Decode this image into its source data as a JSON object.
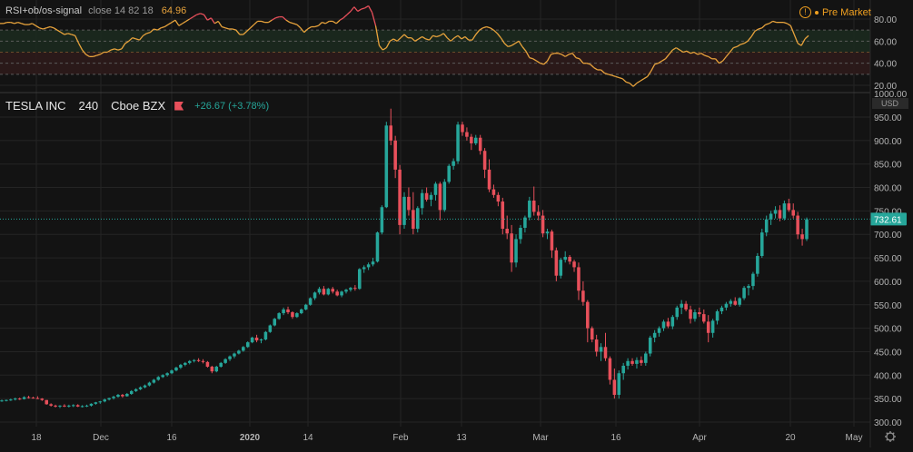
{
  "rsi": {
    "name": "RSI+ob/os-signal",
    "params": "close 14 82 18",
    "value": "64.96",
    "axis_labels": [
      "80.00",
      "60.00",
      "40.00",
      "20.00"
    ],
    "line_color": "#e8a33c",
    "ob_color": "#e8505b"
  },
  "status": {
    "label": "Pre Market",
    "icon": "info-circle-icon"
  },
  "symbol": {
    "title": "TESLA INC",
    "interval": "240",
    "exchange": "Cboe BZX",
    "change": "+26.67 (+3.78%)",
    "flag_icon": "flag-icon"
  },
  "price_axis": {
    "top_label": "1000.00",
    "currency": "USD",
    "labels": [
      "950.00",
      "900.00",
      "850.00",
      "800.00",
      "750.00",
      "700.00",
      "650.00",
      "600.00",
      "550.00",
      "500.00",
      "450.00",
      "400.00",
      "350.00",
      "300.00"
    ],
    "last_price": "732.61"
  },
  "time_axis": {
    "labels": [
      "18",
      "Dec",
      "16",
      "2020",
      "14",
      "Feb",
      "13",
      "Mar",
      "16",
      "Apr",
      "20",
      "May"
    ]
  },
  "settings_icon": "gear-icon",
  "colors": {
    "up": "#26a69a",
    "down": "#e8505b",
    "bg": "#131313",
    "grid": "#242424",
    "text": "#b4b4b4"
  },
  "chart_data": [
    {
      "type": "candlestick",
      "title": "TESLA INC",
      "ylabel": "USD",
      "ylim": [
        290,
        1010
      ],
      "ohlc_approx": [
        [
          346,
          348,
          343,
          346
        ],
        [
          346,
          348,
          344,
          347
        ],
        [
          347,
          350,
          345,
          348
        ],
        [
          348,
          352,
          346,
          350
        ],
        [
          350,
          352,
          347,
          349
        ],
        [
          349,
          355,
          348,
          353
        ],
        [
          353,
          356,
          350,
          352
        ],
        [
          352,
          354,
          350,
          351
        ],
        [
          351,
          355,
          349,
          350
        ],
        [
          350,
          351,
          345,
          347
        ],
        [
          347,
          347,
          337,
          338
        ],
        [
          338,
          340,
          333,
          335
        ],
        [
          335,
          337,
          331,
          333
        ],
        [
          333,
          336,
          330,
          335
        ],
        [
          335,
          338,
          332,
          334
        ],
        [
          334,
          337,
          331,
          335
        ],
        [
          335,
          338,
          332,
          336
        ],
        [
          336,
          338,
          332,
          333
        ],
        [
          333,
          336,
          331,
          334
        ],
        [
          334,
          337,
          332,
          335
        ],
        [
          335,
          340,
          333,
          339
        ],
        [
          339,
          343,
          337,
          342
        ],
        [
          342,
          345,
          339,
          344
        ],
        [
          344,
          350,
          342,
          348
        ],
        [
          348,
          352,
          346,
          351
        ],
        [
          351,
          356,
          348,
          354
        ],
        [
          354,
          360,
          352,
          358
        ],
        [
          358,
          360,
          352,
          355
        ],
        [
          355,
          362,
          354,
          360
        ],
        [
          360,
          368,
          358,
          366
        ],
        [
          366,
          372,
          364,
          370
        ],
        [
          370,
          376,
          368,
          374
        ],
        [
          374,
          380,
          372,
          378
        ],
        [
          378,
          386,
          376,
          384
        ],
        [
          384,
          392,
          382,
          390
        ],
        [
          390,
          398,
          388,
          396
        ],
        [
          396,
          402,
          394,
          400
        ],
        [
          400,
          406,
          397,
          404
        ],
        [
          404,
          412,
          402,
          410
        ],
        [
          410,
          418,
          408,
          416
        ],
        [
          416,
          424,
          413,
          422
        ],
        [
          422,
          428,
          419,
          426
        ],
        [
          426,
          432,
          423,
          430
        ],
        [
          430,
          434,
          427,
          432
        ],
        [
          432,
          436,
          428,
          430
        ],
        [
          430,
          434,
          425,
          428
        ],
        [
          428,
          430,
          416,
          418
        ],
        [
          418,
          420,
          404,
          408
        ],
        [
          408,
          420,
          406,
          418
        ],
        [
          418,
          428,
          416,
          426
        ],
        [
          426,
          436,
          424,
          434
        ],
        [
          434,
          442,
          430,
          440
        ],
        [
          440,
          448,
          436,
          446
        ],
        [
          446,
          454,
          444,
          452
        ],
        [
          452,
          462,
          450,
          460
        ],
        [
          460,
          472,
          458,
          470
        ],
        [
          470,
          482,
          468,
          480
        ],
        [
          480,
          486,
          470,
          474
        ],
        [
          474,
          478,
          468,
          476
        ],
        [
          476,
          494,
          474,
          492
        ],
        [
          492,
          508,
          490,
          506
        ],
        [
          506,
          522,
          504,
          520
        ],
        [
          520,
          534,
          518,
          532
        ],
        [
          532,
          544,
          528,
          540
        ],
        [
          540,
          546,
          530,
          534
        ],
        [
          534,
          536,
          520,
          524
        ],
        [
          524,
          534,
          522,
          532
        ],
        [
          532,
          542,
          530,
          540
        ],
        [
          540,
          552,
          538,
          550
        ],
        [
          550,
          566,
          548,
          564
        ],
        [
          564,
          578,
          560,
          576
        ],
        [
          576,
          588,
          572,
          584
        ],
        [
          584,
          590,
          570,
          572
        ],
        [
          572,
          586,
          570,
          584
        ],
        [
          584,
          588,
          574,
          578
        ],
        [
          578,
          582,
          568,
          570
        ],
        [
          570,
          580,
          566,
          578
        ],
        [
          578,
          584,
          574,
          582
        ],
        [
          582,
          588,
          578,
          586
        ],
        [
          586,
          592,
          580,
          584
        ],
        [
          584,
          628,
          582,
          626
        ],
        [
          626,
          634,
          618,
          630
        ],
        [
          630,
          640,
          624,
          636
        ],
        [
          636,
          650,
          632,
          642
        ],
        [
          642,
          706,
          640,
          704
        ],
        [
          704,
          762,
          700,
          758
        ],
        [
          758,
          940,
          756,
          932
        ],
        [
          932,
          968,
          890,
          900
        ],
        [
          900,
          910,
          820,
          838
        ],
        [
          838,
          848,
          700,
          720
        ],
        [
          720,
          790,
          712,
          780
        ],
        [
          780,
          800,
          740,
          752
        ],
        [
          752,
          790,
          700,
          712
        ],
        [
          712,
          760,
          704,
          756
        ],
        [
          756,
          796,
          742,
          788
        ],
        [
          788,
          800,
          770,
          774
        ],
        [
          774,
          790,
          760,
          784
        ],
        [
          784,
          812,
          772,
          808
        ],
        [
          808,
          812,
          730,
          752
        ],
        [
          752,
          818,
          748,
          812
        ],
        [
          812,
          850,
          808,
          846
        ],
        [
          846,
          862,
          838,
          856
        ],
        [
          856,
          940,
          850,
          934
        ],
        [
          934,
          940,
          910,
          918
        ],
        [
          918,
          928,
          900,
          908
        ],
        [
          908,
          914,
          880,
          894
        ],
        [
          894,
          912,
          890,
          906
        ],
        [
          906,
          912,
          870,
          878
        ],
        [
          878,
          884,
          820,
          838
        ],
        [
          838,
          860,
          790,
          796
        ],
        [
          796,
          806,
          778,
          784
        ],
        [
          784,
          790,
          760,
          770
        ],
        [
          770,
          778,
          700,
          712
        ],
        [
          712,
          740,
          690,
          702
        ],
        [
          702,
          720,
          620,
          640
        ],
        [
          640,
          700,
          630,
          690
        ],
        [
          690,
          720,
          680,
          714
        ],
        [
          714,
          740,
          704,
          736
        ],
        [
          736,
          780,
          730,
          772
        ],
        [
          772,
          802,
          740,
          748
        ],
        [
          748,
          762,
          730,
          740
        ],
        [
          740,
          752,
          694,
          702
        ],
        [
          702,
          712,
          690,
          706
        ],
        [
          706,
          710,
          650,
          666
        ],
        [
          666,
          672,
          600,
          612
        ],
        [
          612,
          650,
          606,
          646
        ],
        [
          646,
          664,
          640,
          652
        ],
        [
          652,
          656,
          636,
          642
        ],
        [
          642,
          646,
          620,
          630
        ],
        [
          630,
          640,
          560,
          580
        ],
        [
          580,
          600,
          548,
          556
        ],
        [
          556,
          560,
          470,
          500
        ],
        [
          500,
          504,
          470,
          476
        ],
        [
          476,
          486,
          440,
          450
        ],
        [
          450,
          468,
          430,
          460
        ],
        [
          460,
          490,
          430,
          436
        ],
        [
          436,
          440,
          380,
          390
        ],
        [
          390,
          414,
          350,
          358
        ],
        [
          358,
          410,
          350,
          404
        ],
        [
          404,
          426,
          390,
          420
        ],
        [
          420,
          436,
          412,
          430
        ],
        [
          430,
          436,
          420,
          424
        ],
        [
          424,
          438,
          414,
          432
        ],
        [
          432,
          440,
          420,
          426
        ],
        [
          426,
          450,
          420,
          446
        ],
        [
          446,
          484,
          440,
          480
        ],
        [
          480,
          496,
          470,
          490
        ],
        [
          490,
          504,
          482,
          500
        ],
        [
          500,
          518,
          494,
          514
        ],
        [
          514,
          522,
          500,
          504
        ],
        [
          504,
          528,
          498,
          524
        ],
        [
          524,
          548,
          518,
          544
        ],
        [
          544,
          560,
          530,
          552
        ],
        [
          552,
          558,
          536,
          540
        ],
        [
          540,
          548,
          510,
          520
        ],
        [
          520,
          540,
          514,
          534
        ],
        [
          534,
          544,
          524,
          530
        ],
        [
          530,
          540,
          510,
          514
        ],
        [
          514,
          528,
          470,
          490
        ],
        [
          490,
          520,
          480,
          516
        ],
        [
          516,
          540,
          508,
          536
        ],
        [
          536,
          548,
          530,
          544
        ],
        [
          544,
          556,
          538,
          552
        ],
        [
          552,
          562,
          546,
          558
        ],
        [
          558,
          566,
          548,
          550
        ],
        [
          550,
          566,
          546,
          564
        ],
        [
          564,
          590,
          560,
          586
        ],
        [
          586,
          594,
          570,
          590
        ],
        [
          590,
          620,
          582,
          616
        ],
        [
          616,
          660,
          610,
          654
        ],
        [
          654,
          712,
          650,
          704
        ],
        [
          704,
          740,
          696,
          732
        ],
        [
          732,
          750,
          720,
          744
        ],
        [
          744,
          760,
          734,
          752
        ],
        [
          752,
          762,
          728,
          734
        ],
        [
          734,
          772,
          730,
          766
        ],
        [
          766,
          776,
          748,
          752
        ],
        [
          752,
          766,
          734,
          740
        ],
        [
          740,
          748,
          690,
          700
        ],
        [
          700,
          712,
          676,
          690
        ],
        [
          690,
          736,
          686,
          732
        ]
      ]
    },
    {
      "type": "line",
      "title": "RSI+ob/os-signal",
      "ylim": [
        15,
        95
      ],
      "reference_lines": [
        30,
        40,
        50,
        60,
        70
      ],
      "values": [
        76,
        76,
        77,
        77,
        76,
        77,
        76,
        75,
        75,
        76,
        74,
        72,
        71,
        72,
        73,
        72,
        70,
        68,
        66,
        67,
        66,
        65,
        58,
        52,
        48,
        46,
        46,
        47,
        48,
        50,
        50,
        52,
        53,
        52,
        53,
        58,
        60,
        63,
        62,
        61,
        65,
        67,
        68,
        71,
        70,
        72,
        73,
        75,
        77,
        79,
        74,
        76,
        78,
        80,
        82,
        84,
        85,
        84,
        79,
        81,
        76,
        78,
        73,
        72,
        71,
        71,
        70,
        66,
        66,
        69,
        72,
        75,
        78,
        78,
        77,
        77,
        79,
        81,
        82,
        82,
        79,
        77,
        76,
        75,
        72,
        68,
        71,
        73,
        73,
        74,
        77,
        76,
        78,
        78,
        76,
        79,
        81,
        84,
        87,
        91,
        87,
        89,
        90,
        92,
        86,
        74,
        56,
        52,
        54,
        60,
        62,
        60,
        63,
        66,
        63,
        63,
        60,
        62,
        64,
        62,
        61,
        65,
        64,
        65,
        67,
        63,
        60,
        63,
        65,
        62,
        64,
        61,
        61,
        66,
        70,
        72,
        73,
        72,
        70,
        67,
        63,
        58,
        55,
        56,
        58,
        60,
        55,
        51,
        45,
        44,
        42,
        40,
        39,
        42,
        48,
        49,
        49,
        48,
        46,
        48,
        49,
        45,
        44,
        40,
        40,
        39,
        36,
        34,
        34,
        31,
        30,
        29,
        28,
        27,
        26,
        23,
        22,
        19,
        22,
        24,
        26,
        28,
        33,
        39,
        40,
        42,
        44,
        48,
        52,
        54,
        52,
        50,
        51,
        49,
        50,
        48,
        49,
        47,
        46,
        44,
        44,
        40,
        42,
        46,
        50,
        54,
        55,
        57,
        58,
        60,
        64,
        69,
        71,
        72,
        75,
        76,
        78,
        77,
        77,
        77,
        76,
        74,
        66,
        58,
        56,
        62,
        65
      ]
    }
  ]
}
